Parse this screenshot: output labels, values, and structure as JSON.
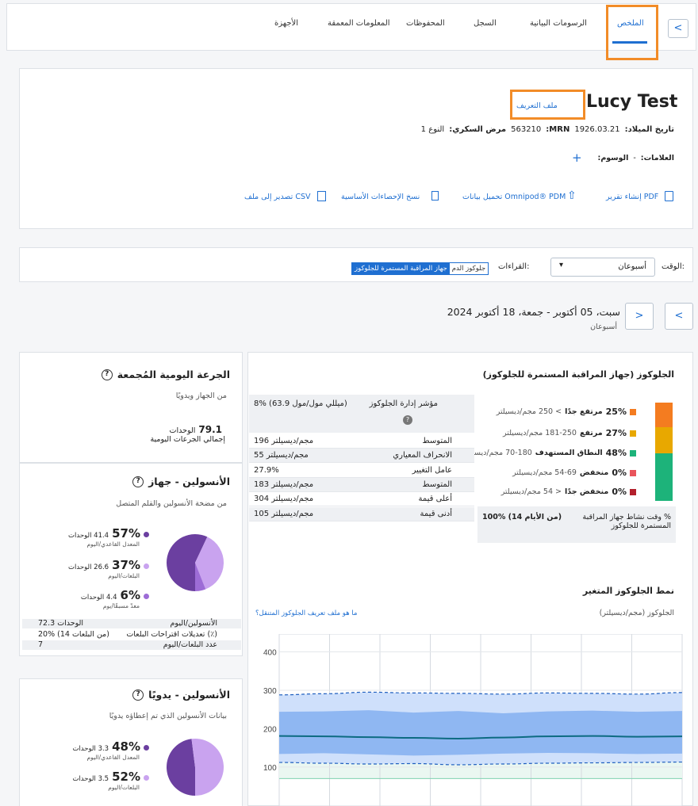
{
  "tabs": [
    "الملخص",
    "الرسومات البيانية",
    "السجل",
    "المحفوظات",
    "المعلومات المعمقة",
    "الأجهزة"
  ],
  "nav": {
    "prev": "<",
    "next": ">",
    "back": "<"
  },
  "patient": {
    "name": "Lucy Test",
    "profile_link": "ملف التعريف",
    "dob_label": "تاريخ الميلاد:",
    "dob": "1926.03.21",
    "mrn_label": "MRN:",
    "mrn": "563210",
    "diabetes_label": "مرض السكري:",
    "diabetes_type": "النوع 1",
    "tags_label": "العلامات:",
    "tags_value": "-",
    "labels_label": "الوسوم:",
    "add": "+"
  },
  "actions": {
    "pdf": "إنشاء تقرير PDF",
    "upload": "تحميل بيانات Omnipod® PDM",
    "copy": "نسخ الإحصاءات الأساسية",
    "csv": "تصدير إلى ملف CSV"
  },
  "filters": {
    "time_label": "الوقت:",
    "time_value": "أسبوعان",
    "readings_label": "القراءات:",
    "opt_bg": "جلوكوز الدم",
    "opt_cgm": "جهاز المراقبة المستمرة للجلوكوز"
  },
  "date": {
    "range": "سبت، 05 أكتوبر - جمعة، 18 أكتوبر 2024",
    "sub": "أسبوعان"
  },
  "glucose": {
    "title": "الجلوكوز (جهاز المراقبة المستمرة للجلوكوز)",
    "ranges": [
      {
        "pct": "25%",
        "label": "مرتفع جدًا",
        "range": "> 250 مجم/ديسيلتر",
        "color": "#f47c20"
      },
      {
        "pct": "27%",
        "label": "مرتفع",
        "range": "181-250 مجم/ديسيلتر",
        "color": "#e8a800"
      },
      {
        "pct": "48%",
        "label": "النطاق المستهدف",
        "range": "70-180 مجم/ديسيلتر",
        "color": "#1db37a"
      },
      {
        "pct": "0%",
        "label": "منخفض",
        "range": "54-69 مجم/ديسيلتر",
        "color": "#e9545b"
      },
      {
        "pct": "0%",
        "label": "منخفض جدًا",
        "range": "< 54 مجم/ديسيلتر",
        "color": "#b3202c"
      }
    ],
    "cgm_active_label": "% وقت نشاط جهاز المراقبة المستمرة للجلوكوز",
    "cgm_active_value": "100% (14 من الأيام)",
    "stats": [
      {
        "label": "مؤشر إدارة الجلوكوز",
        "value": "8% (63.9 ميللي مول/مول)"
      },
      {
        "label": "المتوسط",
        "value": "196 مجم/ديسيلتر"
      },
      {
        "label": "الانحراف المعياري",
        "value": "55 مجم/ديسيلتر"
      },
      {
        "label": "عامل التغيير",
        "value": "27.9%"
      },
      {
        "label": "المتوسط",
        "value": "183 مجم/ديسيلتر"
      },
      {
        "label": "أعلى قيمة",
        "value": "304 مجم/ديسيلتر"
      },
      {
        "label": "أدنى قيمة",
        "value": "105 مجم/ديسيلتر"
      }
    ],
    "info": "?"
  },
  "agp": {
    "title": "نمط الجلوكوز المتغير",
    "axis_label": "الجلوكوز  (مجم/ديسيلتر)",
    "help_link": "ما هو ملف تعريف الجلوكوز المتنقل؟",
    "ticks": [
      "400",
      "300",
      "200",
      "100"
    ]
  },
  "chart_data": {
    "type": "area",
    "ylim": [
      0,
      450
    ],
    "yticks": [
      100,
      200,
      300,
      400
    ],
    "series": [
      {
        "name": "",
        "values": [
          288,
          291,
          295,
          293,
          292,
          290,
          293,
          292,
          290,
          294
        ]
      },
      {
        "name": "",
        "values": [
          244,
          245,
          248,
          242,
          246,
          240,
          245,
          247,
          244,
          246
        ]
      },
      {
        "name": "",
        "values": [
          181,
          180,
          178,
          176,
          174,
          177,
          180,
          181,
          179,
          180
        ]
      },
      {
        "name": "",
        "values": [
          134,
          136,
          133,
          130,
          132,
          135,
          137,
          136,
          134,
          135
        ]
      },
      {
        "name": "",
        "values": [
          112,
          110,
          108,
          109,
          106,
          108,
          110,
          111,
          112,
          113
        ]
      }
    ],
    "target_range": [
      70,
      180
    ]
  },
  "daily_dose": {
    "title": "الجرعة اليومية المُجمعة",
    "subtitle": "من الجهاز ويدويًا",
    "value": "79.1",
    "unit": "الوحدات",
    "label": "إجمالي الجرعات اليومية"
  },
  "pump": {
    "title": "الأنسولين - جهاز",
    "subtitle": "من مضخة الأنسولين والقلم المتصل",
    "items": [
      {
        "pct": "57%",
        "units": "41.4 الوحدات",
        "label": "المعدل القاعدي/اليوم",
        "color": "#6b3fa0"
      },
      {
        "pct": "37%",
        "units": "26.6 الوحدات",
        "label": "البلعات/اليوم",
        "color": "#c9a3ef"
      },
      {
        "pct": "6%",
        "units": "4.4 الوحدات",
        "label": "معدّ مسبقًا/يوم",
        "color": "#9d6cd6"
      }
    ],
    "pie": [
      57,
      37,
      6
    ],
    "rows": [
      {
        "label": "الأنسولين/اليوم",
        "value": "72.3 الوحدات"
      },
      {
        "label": "تعديلات اقتراحات البلعات (٪)",
        "value": "20% (14 من البلعات)"
      },
      {
        "label": "عدد البلعات/اليوم",
        "value": "7"
      }
    ]
  },
  "manual": {
    "title": "الأنسولين - يدويًا",
    "subtitle": "بيانات الأنسولين الذي تم إعطاؤه يدويًا",
    "items": [
      {
        "pct": "48%",
        "units": "3.3 الوحدات",
        "label": "المعدل القاعدي/اليوم",
        "color": "#6b3fa0"
      },
      {
        "pct": "52%",
        "units": "3.5 الوحدات",
        "label": "البلعات/اليوم",
        "color": "#c9a3ef"
      }
    ],
    "pie": [
      48,
      52
    ]
  }
}
